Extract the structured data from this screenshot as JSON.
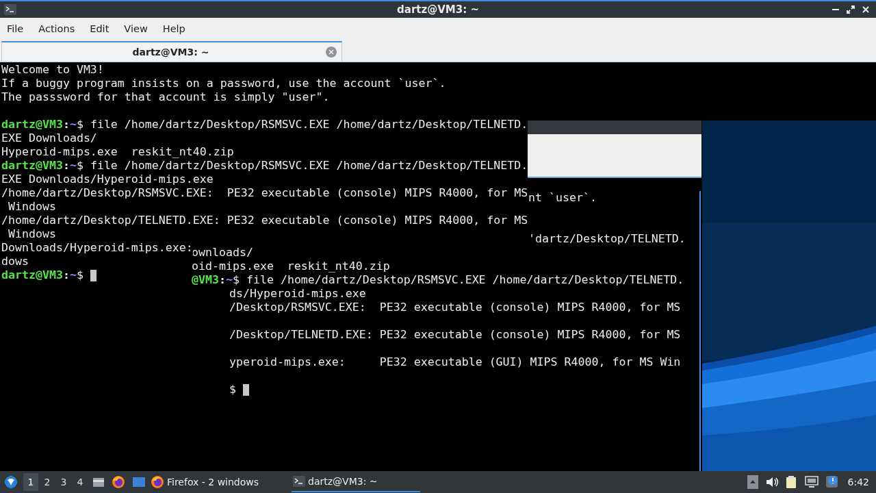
{
  "window": {
    "title": "dartz@VM3: ~"
  },
  "menu": [
    "File",
    "Actions",
    "Edit",
    "View",
    "Help"
  ],
  "tabs": [
    {
      "label": "dartz@VM3: ~",
      "selected": true
    }
  ],
  "terminal": {
    "lines": [
      {
        "kind": "text",
        "text": "Welcome to VM3!"
      },
      {
        "kind": "text",
        "text": "If a buggy program insists on a password, use the account `user`."
      },
      {
        "kind": "text",
        "text": "The passsword for that account is simply \"user\"."
      },
      {
        "kind": "blank"
      },
      {
        "kind": "prompt",
        "user": "dartz@VM3",
        "sep": ":",
        "path": "~",
        "command": "$ file /home/dartz/Desktop/RSMSVC.EXE /home/dartz/Desktop/TELNETD.",
        "cursor": false
      },
      {
        "kind": "text",
        "text": "EXE Downloads/"
      },
      {
        "kind": "text",
        "text": "Hyperoid-mips.exe  reskit_nt40.zip"
      },
      {
        "kind": "prompt",
        "user": "dartz@VM3",
        "sep": ":",
        "path": "~",
        "command": "$ file /home/dartz/Desktop/RSMSVC.EXE /home/dartz/Desktop/TELNETD.",
        "cursor": false
      },
      {
        "kind": "text",
        "text": "EXE Downloads/Hyperoid-mips.exe"
      },
      {
        "kind": "text",
        "text": "/home/dartz/Desktop/RSMSVC.EXE:  PE32 executable (console) MIPS R4000, for MS"
      },
      {
        "kind": "text",
        "text": " Windows"
      },
      {
        "kind": "text",
        "text": "/home/dartz/Desktop/TELNETD.EXE: PE32 executable (console) MIPS R4000, for MS"
      },
      {
        "kind": "text",
        "text": " Windows"
      },
      {
        "kind": "text",
        "text": "Downloads/Hyperoid-mips.exe:"
      },
      {
        "kind": "text",
        "text": "dows"
      },
      {
        "kind": "prompt",
        "user": "dartz@VM3",
        "sep": ":",
        "path": "~",
        "command": "$ ",
        "cursor": true
      }
    ],
    "ghost_lines": [
      {
        "kind": "right",
        "text": "nt `user`."
      },
      {
        "kind": "blank"
      },
      {
        "kind": "blank"
      },
      {
        "kind": "right",
        "text": "'dartz/Desktop/TELNETD."
      },
      {
        "kind": "full",
        "text": "ownloads/"
      },
      {
        "kind": "full",
        "text": "oid-mips.exe  reskit_nt40.zip"
      },
      {
        "kind": "prompt",
        "user": "@VM3",
        "sep": ":",
        "path": "~",
        "command": "$ file /home/dartz/Desktop/RSMSVC.EXE /home/dartz/Desktop/TELNETD.",
        "cursor": false
      },
      {
        "kind": "mid",
        "text": "ds/Hyperoid-mips.exe"
      },
      {
        "kind": "mid",
        "text": "/Desktop/RSMSVC.EXE:  PE32 executable (console) MIPS R4000, for MS"
      },
      {
        "kind": "blank"
      },
      {
        "kind": "mid",
        "text": "/Desktop/TELNETD.EXE: PE32 executable (console) MIPS R4000, for MS"
      },
      {
        "kind": "blank"
      },
      {
        "kind": "mid",
        "text": "yperoid-mips.exe:     PE32 executable (GUI) MIPS R4000, for MS Win"
      },
      {
        "kind": "blank"
      },
      {
        "kind": "mid",
        "text": "$ ",
        "cursor": true
      }
    ]
  },
  "taskbar": {
    "workspaces": [
      {
        "label": "1",
        "selected": true
      },
      {
        "label": "2",
        "selected": false
      },
      {
        "label": "3",
        "selected": false
      },
      {
        "label": "4",
        "selected": false
      }
    ],
    "tasks": [
      {
        "label": "Firefox - 2 windows",
        "selected": false
      },
      {
        "label": "dartz@VM3: ~",
        "selected": true
      }
    ],
    "clock": "6:42"
  }
}
